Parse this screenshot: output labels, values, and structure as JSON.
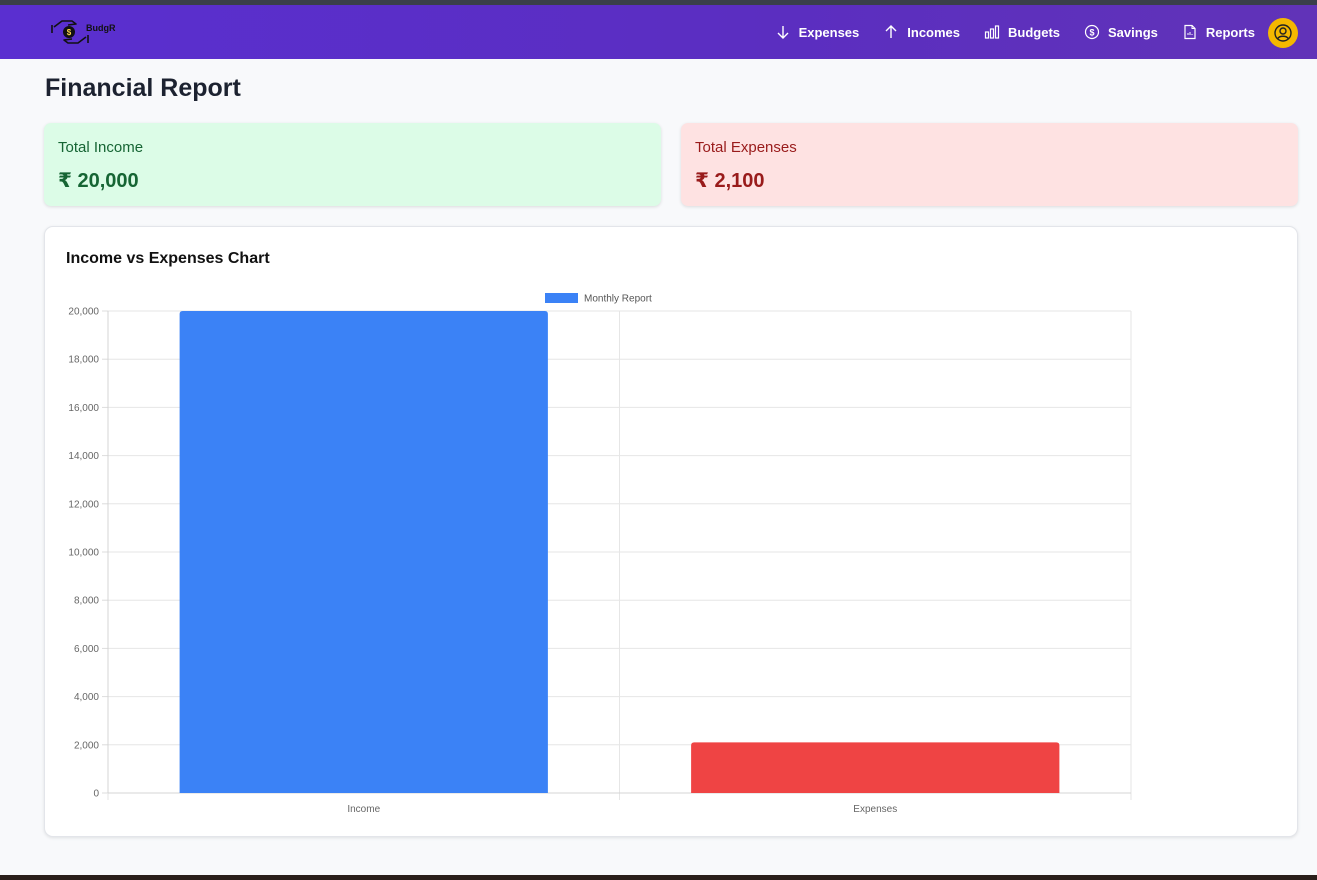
{
  "brand": {
    "name": "BudgR"
  },
  "nav": {
    "items": [
      {
        "label": "Expenses",
        "icon": "arrow-down-icon"
      },
      {
        "label": "Incomes",
        "icon": "arrow-up-icon"
      },
      {
        "label": "Budgets",
        "icon": "bar-chart-icon"
      },
      {
        "label": "Savings",
        "icon": "dollar-circle-icon"
      },
      {
        "label": "Reports",
        "icon": "document-icon"
      }
    ],
    "avatar_icon": "user-circle-icon"
  },
  "page": {
    "title": "Financial Report"
  },
  "summary": {
    "income_label": "Total Income",
    "income_value": "₹ 20,000",
    "expense_label": "Total Expenses",
    "expense_value": "₹ 2,100"
  },
  "chart": {
    "title": "Income vs Expenses Chart"
  },
  "colors": {
    "nav": "#5a2fd0",
    "income_bar": "#3b82f6",
    "expense_bar": "#ef4444",
    "avatar": "#f5b800"
  },
  "chart_data": {
    "type": "bar",
    "categories": [
      "Income",
      "Expenses"
    ],
    "series": [
      {
        "name": "Monthly Report",
        "values": [
          20000,
          2100
        ],
        "colors": [
          "#3b82f6",
          "#ef4444"
        ]
      }
    ],
    "ylim": [
      0,
      20000
    ],
    "yticks": [
      0,
      2000,
      4000,
      6000,
      8000,
      10000,
      12000,
      14000,
      16000,
      18000,
      20000
    ],
    "ytick_labels": [
      "0",
      "2,000",
      "4,000",
      "6,000",
      "8,000",
      "10,000",
      "12,000",
      "14,000",
      "16,000",
      "18,000",
      "20,000"
    ],
    "legend": "top-center",
    "grid": true
  }
}
